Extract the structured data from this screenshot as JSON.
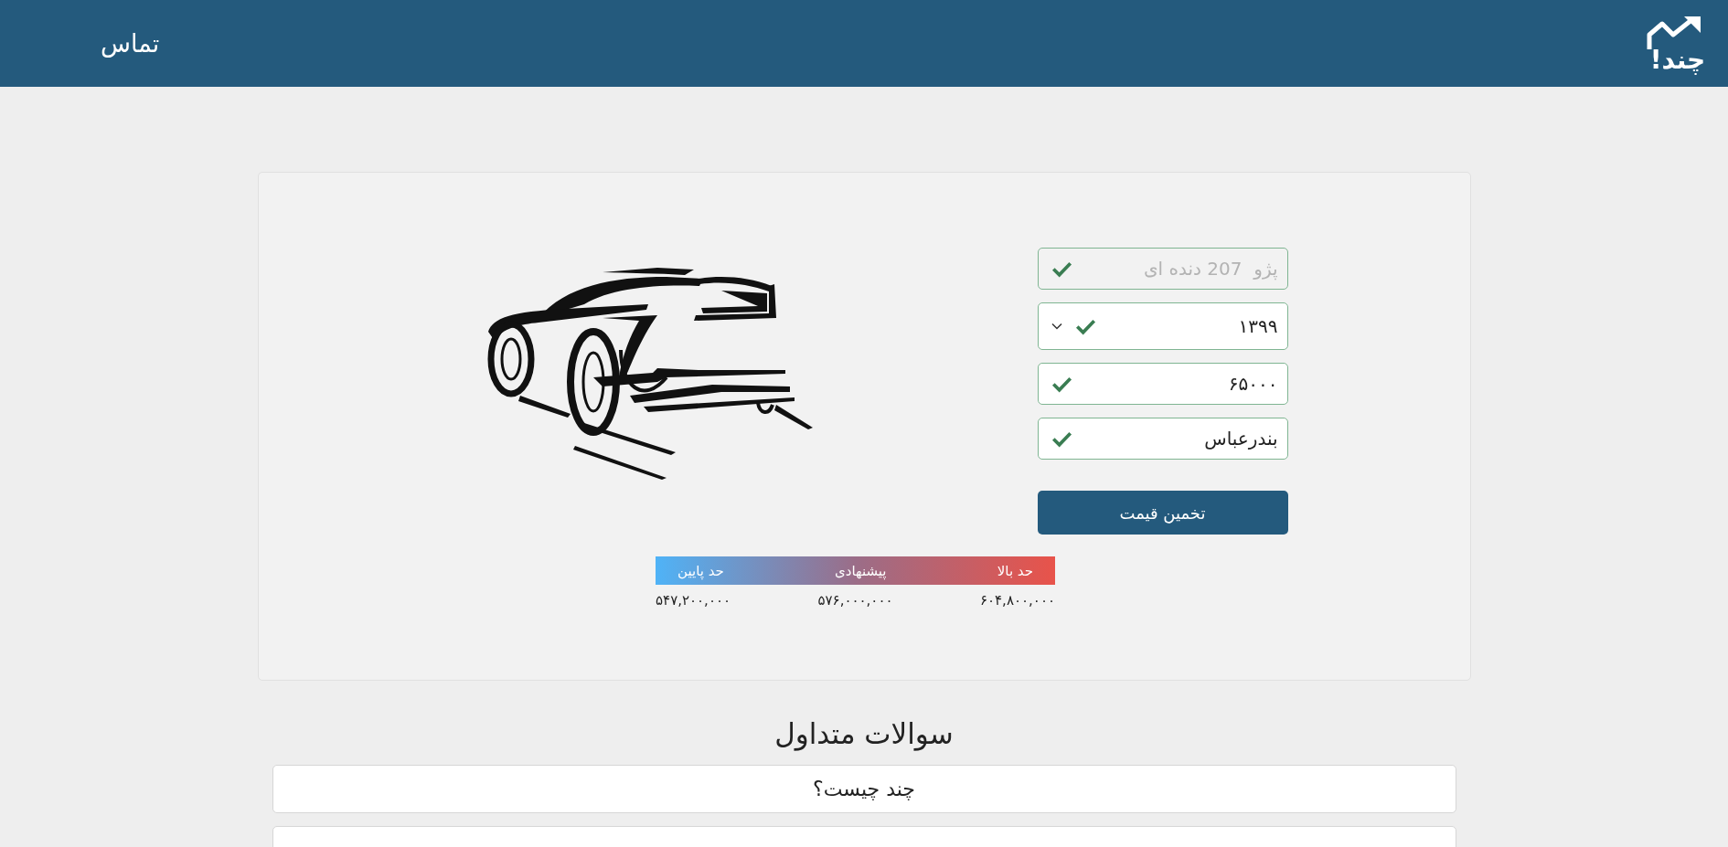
{
  "header": {
    "logo_text": "چند!",
    "nav_link": "تماس"
  },
  "form": {
    "fields": [
      {
        "kind": "input",
        "value": "پژو  207 دنده ای",
        "disabled": true,
        "valid": true
      },
      {
        "kind": "select",
        "value": "۱۳۹۹",
        "disabled": false,
        "valid": true
      },
      {
        "kind": "input",
        "value": "۶۵۰۰۰",
        "disabled": false,
        "valid": true
      },
      {
        "kind": "input",
        "value": "بندرعباس",
        "disabled": false,
        "valid": true
      }
    ],
    "submit": "تخمین قیمت"
  },
  "price_range": [
    {
      "label": "حد بالا",
      "value": "۶۰۴,۸۰۰,۰۰۰"
    },
    {
      "label": "پیشنهادی",
      "value": "۵۷۶,۰۰۰,۰۰۰"
    },
    {
      "label": "حد پایین",
      "value": "۵۴۷,۲۰۰,۰۰۰"
    }
  ],
  "faq": {
    "title": "سوالات متداول",
    "items": [
      {
        "question": "چند چیست؟"
      }
    ]
  }
}
